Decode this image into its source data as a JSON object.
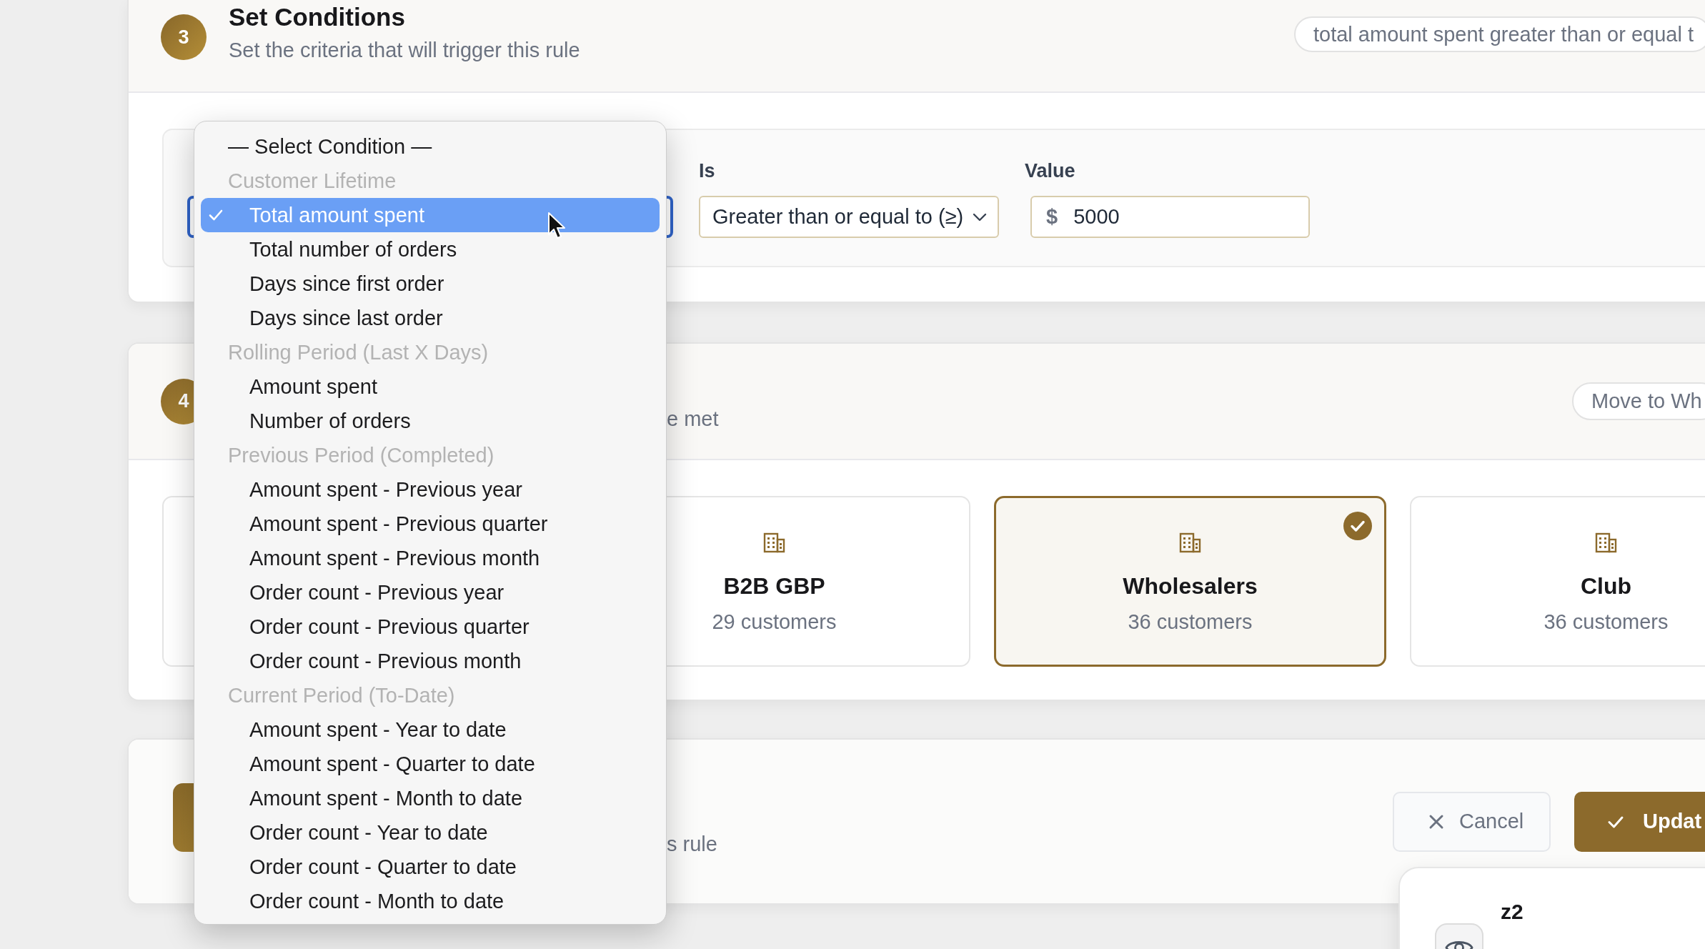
{
  "conditions_step": {
    "number": "3",
    "title": "Set Conditions",
    "subtitle": "Set the criteria that will trigger this rule",
    "summary": "total amount spent greater than or equal t",
    "condition_select": {
      "focused": true
    },
    "operator": {
      "label": "Is",
      "value": "Greater than or equal to (≥)"
    },
    "value_field": {
      "label": "Value",
      "prefix": "$",
      "value": "5000"
    }
  },
  "segment_step": {
    "number": "4",
    "subtitle": "e met",
    "action": "Move to Wh",
    "segments": [
      {
        "name": "B2B GBP",
        "count": "29 customers",
        "selected": false
      },
      {
        "name": "Wholesalers",
        "count": "36 customers",
        "selected": true
      },
      {
        "name": "Club",
        "count": "36 customers",
        "selected": false
      }
    ]
  },
  "save_step": {
    "subtitle": "s rule",
    "buttons": [
      {
        "kind": "secondary",
        "label": "Cancel"
      },
      {
        "kind": "primary",
        "label": "Updat"
      }
    ]
  },
  "condition_menu": {
    "items": [
      {
        "kind": "placeholder",
        "label": "— Select Condition —",
        "selected": false
      },
      {
        "kind": "group",
        "label": "Customer Lifetime"
      },
      {
        "kind": "option",
        "label": "Total amount spent",
        "selected": true
      },
      {
        "kind": "option",
        "label": "Total number of orders",
        "selected": false
      },
      {
        "kind": "option",
        "label": "Days since first order",
        "selected": false
      },
      {
        "kind": "option",
        "label": "Days since last order",
        "selected": false
      },
      {
        "kind": "group",
        "label": "Rolling Period (Last X Days)"
      },
      {
        "kind": "option",
        "label": "Amount spent",
        "selected": false
      },
      {
        "kind": "option",
        "label": "Number of orders",
        "selected": false
      },
      {
        "kind": "group",
        "label": "Previous Period (Completed)"
      },
      {
        "kind": "option",
        "label": "Amount spent - Previous year",
        "selected": false
      },
      {
        "kind": "option",
        "label": "Amount spent - Previous quarter",
        "selected": false
      },
      {
        "kind": "option",
        "label": "Amount spent - Previous month",
        "selected": false
      },
      {
        "kind": "option",
        "label": "Order count - Previous year",
        "selected": false
      },
      {
        "kind": "option",
        "label": "Order count - Previous quarter",
        "selected": false
      },
      {
        "kind": "option",
        "label": "Order count - Previous month",
        "selected": false
      },
      {
        "kind": "group",
        "label": "Current Period (To-Date)"
      },
      {
        "kind": "option",
        "label": "Amount spent - Year to date",
        "selected": false
      },
      {
        "kind": "option",
        "label": "Amount spent - Quarter to date",
        "selected": false
      },
      {
        "kind": "option",
        "label": "Amount spent - Month to date",
        "selected": false
      },
      {
        "kind": "option",
        "label": "Order count - Year to date",
        "selected": false
      },
      {
        "kind": "option",
        "label": "Order count - Quarter to date",
        "selected": false
      },
      {
        "kind": "option",
        "label": "Order count - Month to date",
        "selected": false
      }
    ]
  },
  "preview_popup": {
    "title": "z2"
  }
}
